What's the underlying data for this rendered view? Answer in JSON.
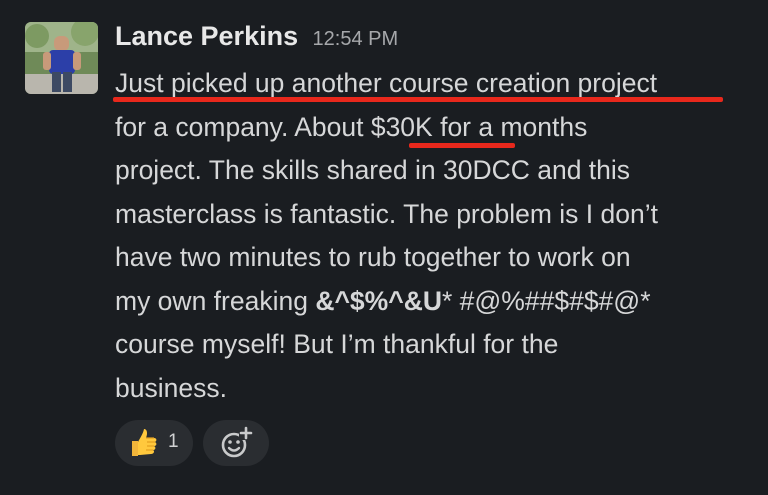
{
  "message": {
    "author": "Lance Perkins",
    "timestamp": "12:54 PM",
    "lines": {
      "l1": "Just picked up another course creation project",
      "l2a": "for a company.  About ",
      "l2b": "$30K",
      "l2c": " for a months",
      "l3": "project.  The skills shared in 30DCC and this",
      "l4": "masterclass is fantastic.  The problem is I don’t",
      "l5": "have two minutes to rub together to work on",
      "l6a": "my own freaking ",
      "l6b": "&^$%^&U",
      "l6c": "* #@%##$#$#@*",
      "l7": "course myself!  But I’m thankful for the",
      "l8": "business."
    }
  },
  "reactions": [
    {
      "emoji": "thumbs-up-icon",
      "count": "1"
    }
  ],
  "annotation_color": "#e8281c",
  "background_color": "#1a1d21"
}
